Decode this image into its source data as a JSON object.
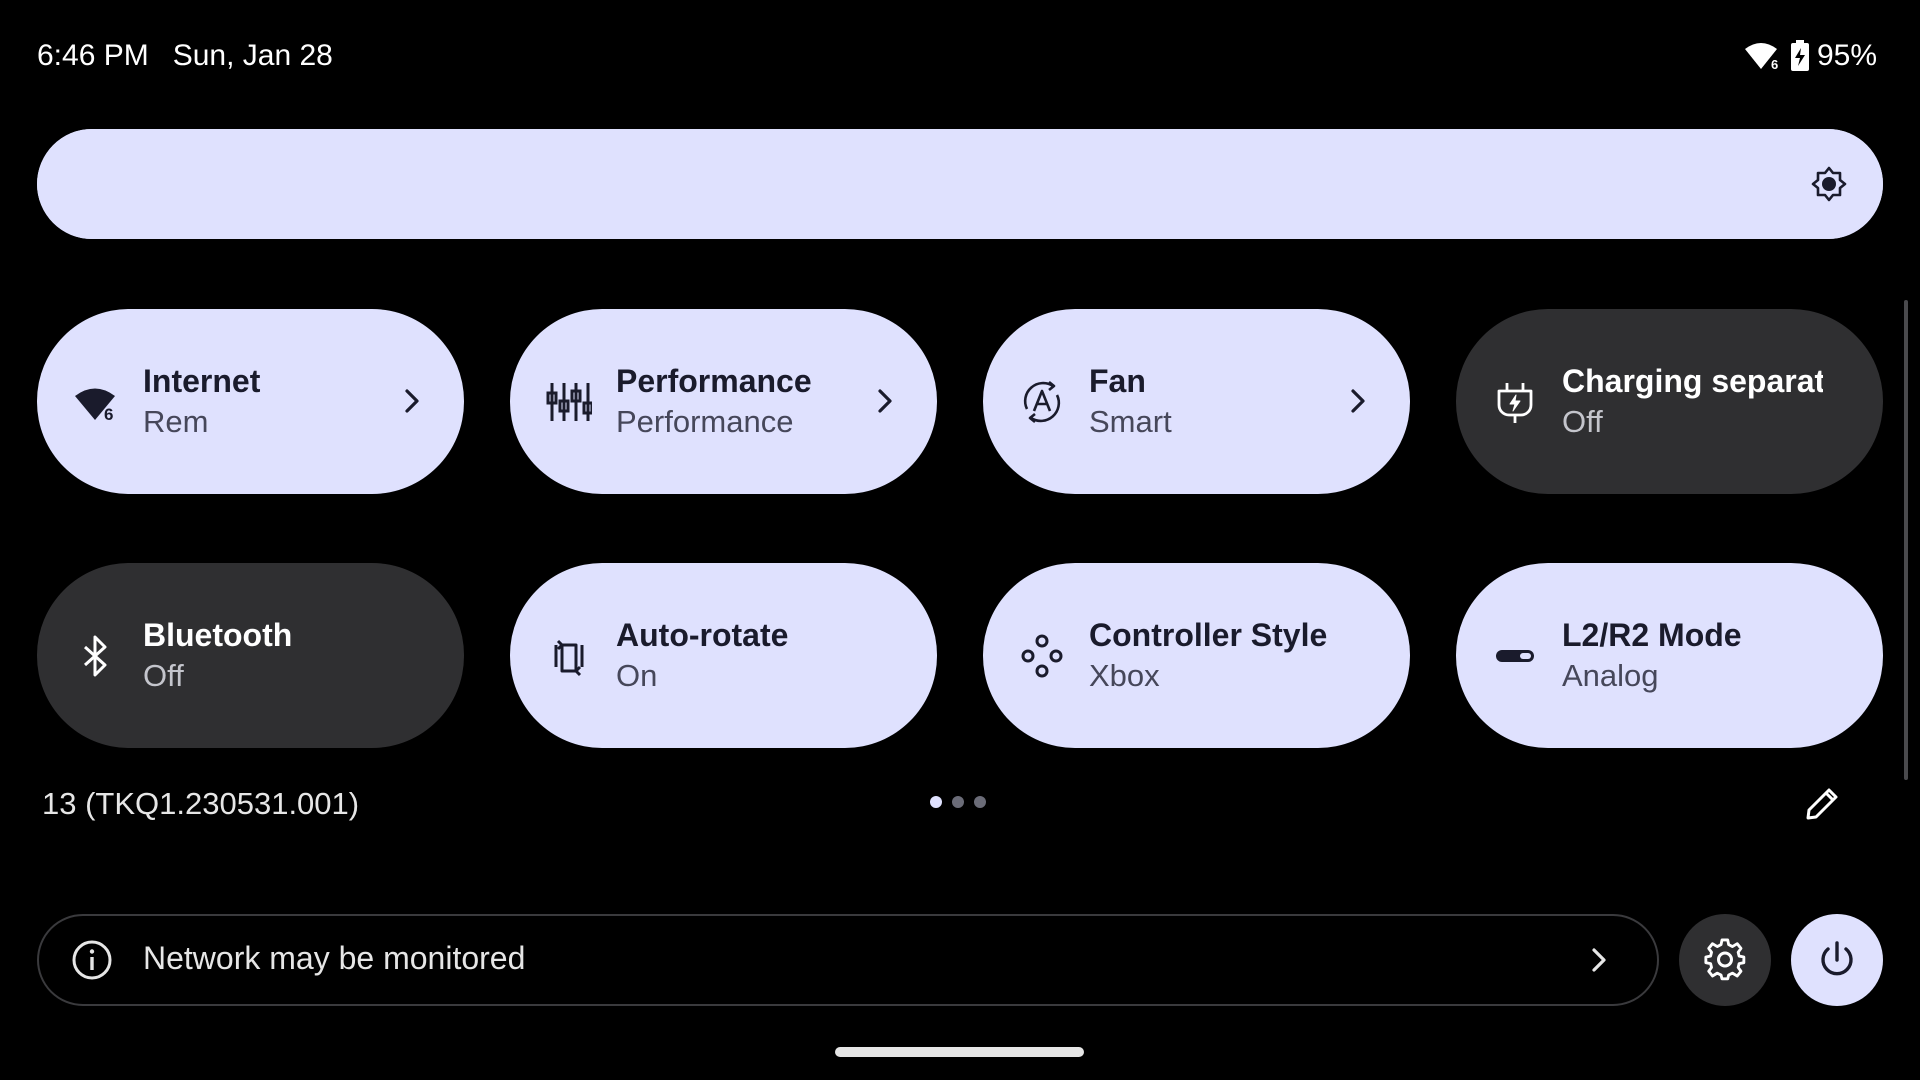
{
  "status_bar": {
    "time": "6:46 PM",
    "date": "Sun, Jan 28",
    "wifi_badge": "6",
    "battery": "95%",
    "icons": [
      "wifi-icon",
      "battery-charging-icon"
    ]
  },
  "brightness": {
    "level": 1.0,
    "icon": "brightness-icon"
  },
  "tiles": [
    {
      "label": "Internet",
      "sub": "Rem",
      "state": "on",
      "icon": "wifi-icon",
      "badge": "6",
      "has_chevron": true
    },
    {
      "label": "Performance",
      "sub": "Performance",
      "state": "on",
      "icon": "performance-sliders-icon",
      "has_chevron": true
    },
    {
      "label": "Fan",
      "sub": "Smart",
      "state": "on",
      "icon": "fan-auto-icon",
      "has_chevron": true
    },
    {
      "label": "Charging separat..",
      "sub": "Off",
      "state": "off",
      "icon": "charging-plug-icon",
      "has_chevron": false
    },
    {
      "label": "Bluetooth",
      "sub": "Off",
      "state": "off",
      "icon": "bluetooth-icon",
      "has_chevron": false
    },
    {
      "label": "Auto-rotate",
      "sub": "On",
      "state": "on",
      "icon": "auto-rotate-icon",
      "has_chevron": false
    },
    {
      "label": "Controller Style",
      "sub": "Xbox",
      "state": "on",
      "icon": "controller-buttons-icon",
      "has_chevron": false
    },
    {
      "label": "L2/R2 Mode",
      "sub": "Analog",
      "state": "on",
      "icon": "trigger-mode-icon",
      "has_chevron": false
    }
  ],
  "footer": {
    "build": "13 (TKQ1.230531.001)",
    "page_count": 3,
    "active_page": 1
  },
  "security": {
    "text": "Network may be monitored"
  },
  "colors": {
    "tile_on": "#dfe1fe",
    "tile_off": "#2f2f31",
    "background": "#000000"
  }
}
